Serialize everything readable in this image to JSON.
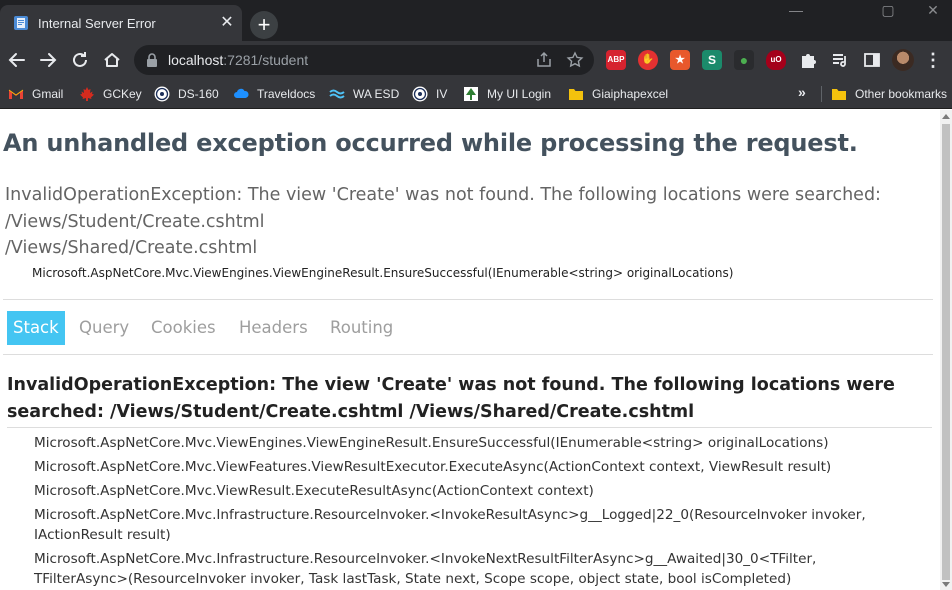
{
  "browser": {
    "tab_title": "Internal Server Error",
    "tab_close": "✕",
    "new_tab": "+",
    "window_controls": [
      "—",
      "▢",
      "✕"
    ],
    "url_host": "localhost",
    "url_rest": ":7281/student",
    "extensions": [
      {
        "name": "adblock-plus-icon",
        "label": "ABP",
        "color": "#d6232f"
      },
      {
        "name": "adblock-icon",
        "label": "✋",
        "color": "#e33131"
      },
      {
        "name": "star-extension-icon",
        "label": "★",
        "color": "#e8582c"
      },
      {
        "name": "sider-extension-icon",
        "label": "S",
        "color": "#1b8a6b"
      },
      {
        "name": "colorful-extension-icon",
        "label": "●",
        "color": "#4caf50"
      },
      {
        "name": "ublock-origin-icon",
        "label": "uO",
        "color": "#a4001a"
      }
    ],
    "menu_label": "⋮"
  },
  "bookmarks": {
    "items": [
      {
        "name": "bookmark-gmail",
        "label": "Gmail",
        "icon": "gmail-icon",
        "color": "#ea4335"
      },
      {
        "name": "bookmark-gckey",
        "label": "GCKey",
        "icon": "maple-leaf-icon",
        "color": "#d52b1e"
      },
      {
        "name": "bookmark-ds-160",
        "label": "DS-160",
        "icon": "seal-icon",
        "color": "#ffffff"
      },
      {
        "name": "bookmark-traveldocs",
        "label": "Traveldocs",
        "icon": "cloud-icon",
        "color": "#1e90ff"
      },
      {
        "name": "bookmark-wa-esd",
        "label": "WA ESD",
        "icon": "wave-icon",
        "color": "#4fc3f7"
      },
      {
        "name": "bookmark-iv",
        "label": "IV",
        "icon": "seal-icon",
        "color": "#ffffff"
      },
      {
        "name": "bookmark-my-ui-login",
        "label": "My UI Login",
        "icon": "tree-icon",
        "color": "#2e7d32"
      },
      {
        "name": "bookmark-giaiphapexcel",
        "label": "Giaiphapexcel",
        "icon": "folder-icon",
        "color": "#f4c20d"
      }
    ],
    "more": "»",
    "other": "Other bookmarks"
  },
  "page": {
    "heading": "An unhandled exception occurred while processing the request.",
    "error_lines": [
      "InvalidOperationException: The view 'Create' was not found. The following locations were searched:",
      "/Views/Student/Create.cshtml",
      "/Views/Shared/Create.cshtml"
    ],
    "error_location": "Microsoft.AspNetCore.Mvc.ViewEngines.ViewEngineResult.EnsureSuccessful(IEnumerable<string> originalLocations)",
    "tabs": [
      "Stack",
      "Query",
      "Cookies",
      "Headers",
      "Routing"
    ],
    "active_tab": "Stack",
    "stack_title": "InvalidOperationException: The view 'Create' was not found. The following locations were searched: /Views/Student/Create.cshtml /Views/Shared/Create.cshtml",
    "frames": [
      "Microsoft.AspNetCore.Mvc.ViewEngines.ViewEngineResult.EnsureSuccessful(IEnumerable<string> originalLocations)",
      "Microsoft.AspNetCore.Mvc.ViewFeatures.ViewResultExecutor.ExecuteAsync(ActionContext context, ViewResult result)",
      "Microsoft.AspNetCore.Mvc.ViewResult.ExecuteResultAsync(ActionContext context)",
      "Microsoft.AspNetCore.Mvc.Infrastructure.ResourceInvoker.<InvokeResultAsync>g__Logged|22_0(ResourceInvoker invoker, IActionResult result)",
      "Microsoft.AspNetCore.Mvc.Infrastructure.ResourceInvoker.<InvokeNextResultFilterAsync>g__Awaited|30_0<TFilter, TFilterAsync>(ResourceInvoker invoker, Task lastTask, State next, Scope scope, object state, bool isCompleted)"
    ]
  }
}
